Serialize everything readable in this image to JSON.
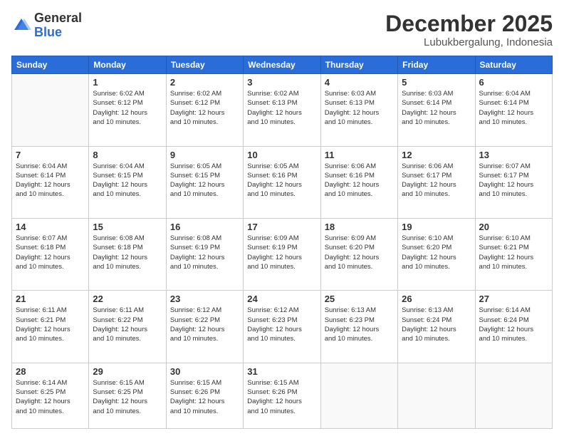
{
  "logo": {
    "general": "General",
    "blue": "Blue"
  },
  "header": {
    "month": "December 2025",
    "location": "Lubukbergalung, Indonesia"
  },
  "weekdays": [
    "Sunday",
    "Monday",
    "Tuesday",
    "Wednesday",
    "Thursday",
    "Friday",
    "Saturday"
  ],
  "days": [
    {
      "date": null
    },
    {
      "date": "1",
      "sunrise": "6:02 AM",
      "sunset": "6:12 PM",
      "daylight": "12 hours and 10 minutes."
    },
    {
      "date": "2",
      "sunrise": "6:02 AM",
      "sunset": "6:12 PM",
      "daylight": "12 hours and 10 minutes."
    },
    {
      "date": "3",
      "sunrise": "6:02 AM",
      "sunset": "6:13 PM",
      "daylight": "12 hours and 10 minutes."
    },
    {
      "date": "4",
      "sunrise": "6:03 AM",
      "sunset": "6:13 PM",
      "daylight": "12 hours and 10 minutes."
    },
    {
      "date": "5",
      "sunrise": "6:03 AM",
      "sunset": "6:14 PM",
      "daylight": "12 hours and 10 minutes."
    },
    {
      "date": "6",
      "sunrise": "6:04 AM",
      "sunset": "6:14 PM",
      "daylight": "12 hours and 10 minutes."
    },
    {
      "date": "7",
      "sunrise": "6:04 AM",
      "sunset": "6:14 PM",
      "daylight": "12 hours and 10 minutes."
    },
    {
      "date": "8",
      "sunrise": "6:04 AM",
      "sunset": "6:15 PM",
      "daylight": "12 hours and 10 minutes."
    },
    {
      "date": "9",
      "sunrise": "6:05 AM",
      "sunset": "6:15 PM",
      "daylight": "12 hours and 10 minutes."
    },
    {
      "date": "10",
      "sunrise": "6:05 AM",
      "sunset": "6:16 PM",
      "daylight": "12 hours and 10 minutes."
    },
    {
      "date": "11",
      "sunrise": "6:06 AM",
      "sunset": "6:16 PM",
      "daylight": "12 hours and 10 minutes."
    },
    {
      "date": "12",
      "sunrise": "6:06 AM",
      "sunset": "6:17 PM",
      "daylight": "12 hours and 10 minutes."
    },
    {
      "date": "13",
      "sunrise": "6:07 AM",
      "sunset": "6:17 PM",
      "daylight": "12 hours and 10 minutes."
    },
    {
      "date": "14",
      "sunrise": "6:07 AM",
      "sunset": "6:18 PM",
      "daylight": "12 hours and 10 minutes."
    },
    {
      "date": "15",
      "sunrise": "6:08 AM",
      "sunset": "6:18 PM",
      "daylight": "12 hours and 10 minutes."
    },
    {
      "date": "16",
      "sunrise": "6:08 AM",
      "sunset": "6:19 PM",
      "daylight": "12 hours and 10 minutes."
    },
    {
      "date": "17",
      "sunrise": "6:09 AM",
      "sunset": "6:19 PM",
      "daylight": "12 hours and 10 minutes."
    },
    {
      "date": "18",
      "sunrise": "6:09 AM",
      "sunset": "6:20 PM",
      "daylight": "12 hours and 10 minutes."
    },
    {
      "date": "19",
      "sunrise": "6:10 AM",
      "sunset": "6:20 PM",
      "daylight": "12 hours and 10 minutes."
    },
    {
      "date": "20",
      "sunrise": "6:10 AM",
      "sunset": "6:21 PM",
      "daylight": "12 hours and 10 minutes."
    },
    {
      "date": "21",
      "sunrise": "6:11 AM",
      "sunset": "6:21 PM",
      "daylight": "12 hours and 10 minutes."
    },
    {
      "date": "22",
      "sunrise": "6:11 AM",
      "sunset": "6:22 PM",
      "daylight": "12 hours and 10 minutes."
    },
    {
      "date": "23",
      "sunrise": "6:12 AM",
      "sunset": "6:22 PM",
      "daylight": "12 hours and 10 minutes."
    },
    {
      "date": "24",
      "sunrise": "6:12 AM",
      "sunset": "6:23 PM",
      "daylight": "12 hours and 10 minutes."
    },
    {
      "date": "25",
      "sunrise": "6:13 AM",
      "sunset": "6:23 PM",
      "daylight": "12 hours and 10 minutes."
    },
    {
      "date": "26",
      "sunrise": "6:13 AM",
      "sunset": "6:24 PM",
      "daylight": "12 hours and 10 minutes."
    },
    {
      "date": "27",
      "sunrise": "6:14 AM",
      "sunset": "6:24 PM",
      "daylight": "12 hours and 10 minutes."
    },
    {
      "date": "28",
      "sunrise": "6:14 AM",
      "sunset": "6:25 PM",
      "daylight": "12 hours and 10 minutes."
    },
    {
      "date": "29",
      "sunrise": "6:15 AM",
      "sunset": "6:25 PM",
      "daylight": "12 hours and 10 minutes."
    },
    {
      "date": "30",
      "sunrise": "6:15 AM",
      "sunset": "6:26 PM",
      "daylight": "12 hours and 10 minutes."
    },
    {
      "date": "31",
      "sunrise": "6:15 AM",
      "sunset": "6:26 PM",
      "daylight": "12 hours and 10 minutes."
    }
  ],
  "labels": {
    "sunrise": "Sunrise:",
    "sunset": "Sunset:",
    "daylight": "Daylight:"
  }
}
